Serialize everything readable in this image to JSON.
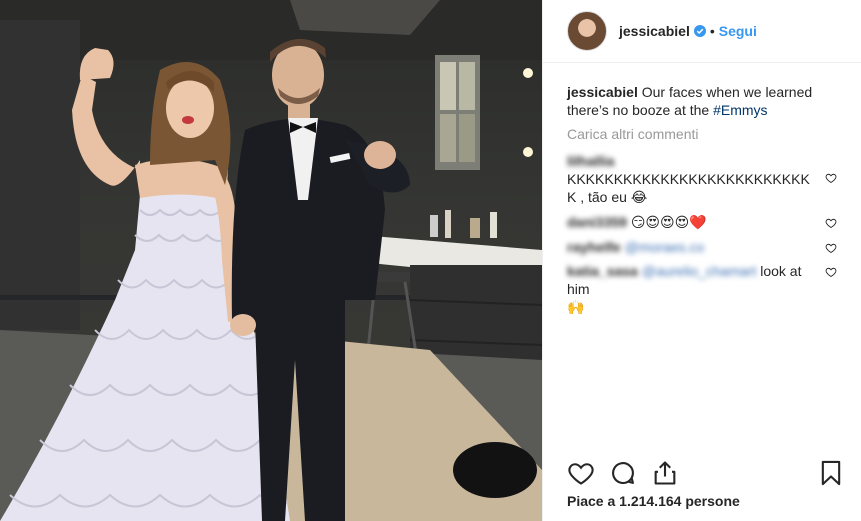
{
  "post": {
    "username": "jessicabiel",
    "separator": "•",
    "follow_label": "Segui",
    "caption_user": "jessicabiel",
    "caption_text": "Our faces when we learned there’s no booze at the",
    "caption_hashtag": "#Emmys",
    "load_more": "Carica altri commenti",
    "likes_text": "Piace a 1.214.164 persone"
  },
  "comments": [
    {
      "user": "lilhallia",
      "text": "KKKKKKKKKKKKKKKKKKKKKKKKKKK , tão eu",
      "emoji": "😂"
    },
    {
      "user": "dani3359",
      "text": "",
      "emoji": "😏😍😍😍❤️"
    },
    {
      "user": "rayhelfe",
      "mention": "@moraes.co",
      "text": ""
    },
    {
      "user": "katia_sasa",
      "mention": "@aurelio_chamart",
      "text": "look at him",
      "emoji": "🙌"
    }
  ],
  "icons": {
    "verified": "verified-badge-icon",
    "like": "heart-icon",
    "comment": "comment-bubble-icon",
    "share": "share-icon",
    "save": "bookmark-icon",
    "comment_like": "small-heart-icon"
  },
  "colors": {
    "link": "#3897f0",
    "hashtag": "#003569",
    "muted": "#999999"
  }
}
